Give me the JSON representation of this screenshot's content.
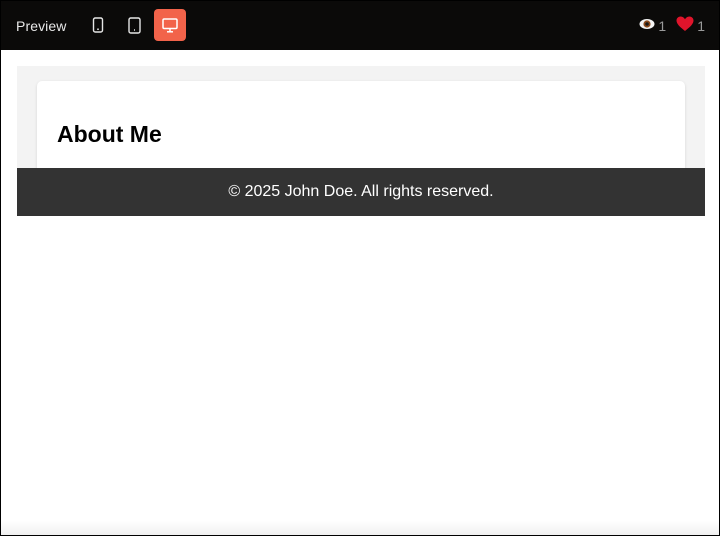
{
  "toolbar": {
    "title": "Preview",
    "devices": [
      {
        "name": "mobile",
        "icon": "mobile-icon",
        "active": false
      },
      {
        "name": "tablet",
        "icon": "tablet-icon",
        "active": false
      },
      {
        "name": "desktop",
        "icon": "desktop-icon",
        "active": true
      }
    ],
    "accent_color": "#f2634a",
    "views": {
      "icon": "eye-icon",
      "count": "1"
    },
    "likes": {
      "icon": "heart-icon",
      "count": "1"
    }
  },
  "page": {
    "heading": "About Me",
    "footer_text": "© 2025 John Doe. All rights reserved."
  }
}
